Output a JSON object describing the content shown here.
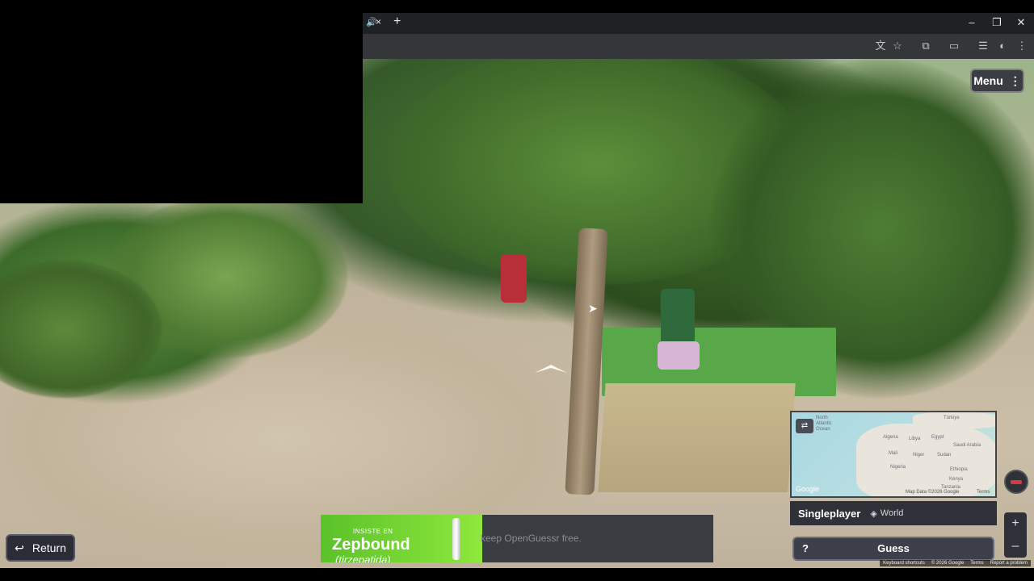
{
  "browser": {
    "tab_close": "×",
    "new_tab": "+",
    "window_controls": [
      "–",
      "❐",
      "✕"
    ],
    "toolbar_icons": [
      "translate-icon",
      "star-icon",
      "extensions-icon",
      "cast-icon",
      "playlist-icon",
      "profile-icon",
      "more-vert-icon"
    ]
  },
  "game": {
    "menu_label": "Menu",
    "return_label": "Return",
    "mode_title": "Singleplayer",
    "mode_map": "World",
    "guess_label": "Guess",
    "guess_help": "?",
    "zoom_in": "+",
    "zoom_out": "–"
  },
  "ad": {
    "small": "INSISTE EN",
    "brand": "Zepbound",
    "sub": "(tirzepatida)",
    "text": "keep OpenGuessr free."
  },
  "minimap": {
    "labels": [
      "North",
      "Atlantic",
      "Ocean",
      "Türkiye",
      "Algeria",
      "Libya",
      "Egypt",
      "Saudi Arabia",
      "Mali",
      "Niger",
      "Sudan",
      "Nigeria",
      "Ethiopia",
      "Kenya",
      "Tanzania"
    ],
    "google": "Google",
    "attribution": "Map Data ©2026 Google",
    "terms": "Terms"
  },
  "footer": {
    "shortcuts": "Keyboard shortcuts",
    "copyright": "© 2026 Google",
    "terms": "Terms",
    "report": "Report a problem"
  },
  "colors": {
    "chrome_dark": "#202124",
    "toolbar": "#35363a",
    "ad_green": "#7ed436",
    "panel": "#2f3038"
  }
}
